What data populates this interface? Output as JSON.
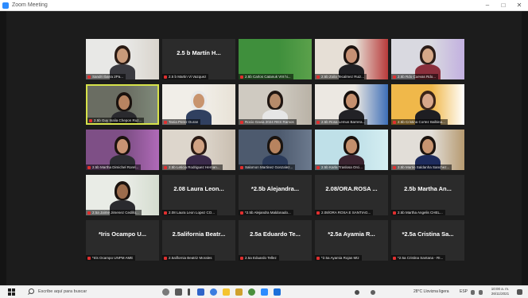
{
  "window": {
    "title": "Zoom Meeting",
    "controls": {
      "minimize": "–",
      "maximize": "□",
      "close": "✕"
    }
  },
  "colors": {
    "zoom_blue": "#2d8cff",
    "stage_bg": "#1c1c1c",
    "tile_bg": "#2b2b2b",
    "active_speaker_border": "#d6e24a",
    "muted_icon": "#e02f2f"
  },
  "participants": [
    {
      "label": "Sandri Ibarra 2Pa...",
      "video": true
    },
    {
      "label": "2.5 b Martin Vi Vazquez",
      "display_name": "2.5 b Martín H...",
      "video": false
    },
    {
      "label": "2.5b Carlos Catanuk VIII hi...",
      "video": true
    },
    {
      "label": "2.5b Zoila Tecalmez Ruiz...",
      "video": true
    },
    {
      "label": "2.5b Rdo Cuevas Rdo...",
      "video": true
    },
    {
      "label": "2.5b Guy Inalia Chepon Ruz...",
      "video": true,
      "speaking": true
    },
    {
      "label": "Tania Perez Duran",
      "video": true
    },
    {
      "label": "Rocio Gavia 2024 RES Ramos",
      "video": true
    },
    {
      "label": "2.5b Rosa Lemus Barrera...",
      "video": true
    },
    {
      "label": "2.5b Cristina Cortez Balbina...",
      "video": true
    },
    {
      "label": "2.5b Martha Dimichel Rorel...",
      "video": true
    },
    {
      "label": "2.5b Leticia Rodriguez Hernan...",
      "video": true
    },
    {
      "label": "Salomon Martinez Gonzalez...",
      "video": true
    },
    {
      "label": "2.5b Karla Traslosa Orci...",
      "video": true
    },
    {
      "label": "2.5b Martin Saldanha Sanchez...",
      "video": true
    },
    {
      "label": "2.5a Jaime Jimenez Cedillo...",
      "video": true
    },
    {
      "label": "2.08 Laura Leon Lopez CO...",
      "display_name": "2.08 Laura Leon...",
      "video": false
    },
    {
      "label": "*2.5b Alejandra Maldonado...",
      "display_name": "*2.5b Alejandra...",
      "video": false
    },
    {
      "label": "2.08/ORA ROSA E SANTIAG...",
      "display_name": "2.08/ORA.ROSA ...",
      "video": false
    },
    {
      "label": "2.5b Martha Angelis CHEL...",
      "display_name": "2.5b Martha An...",
      "video": false
    },
    {
      "label": "*Iris Ocampo UNPM AME",
      "display_name": "*Iris Ocampo U...",
      "video": false
    },
    {
      "label": "2.5alifornia Beatriz Morales",
      "display_name": "2.5alifornia Beatr...",
      "video": false
    },
    {
      "label": "2.5a Eduardo Tellez",
      "display_name": "2.5a Eduardo Te...",
      "video": false
    },
    {
      "label": "*2.5a Ayamia Rojas Mtz",
      "display_name": "*2.5a Ayamia R...",
      "video": false
    },
    {
      "label": "*2.5a Cristina Santana - RI...",
      "display_name": "*2.5a Cristina Sa...",
      "video": false
    }
  ],
  "taskbar": {
    "search_placeholder": "Escribe aquí para buscar",
    "weather": "28°C Llovizna ligera",
    "language": "ESP",
    "time": "10:00 a. m.",
    "date": "26/11/2021"
  }
}
